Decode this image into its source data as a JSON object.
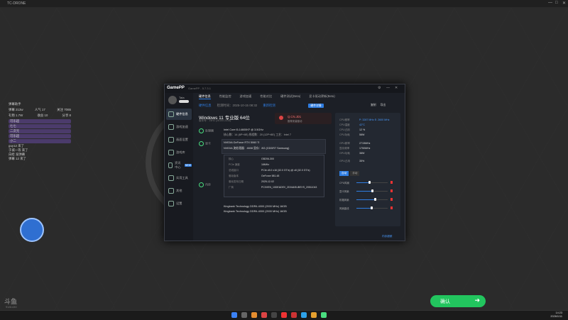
{
  "window": {
    "title": "TC-DRONE"
  },
  "chat": {
    "header": "弹幕助手",
    "stats": [
      [
        "弹幕 213w",
        "人气 17",
        "关注 7065"
      ],
      [
        "礼物 1.7W",
        "收益 10",
        "分享 8"
      ]
    ],
    "hl_lines": [
      "可乐超",
      "七七",
      "二次元",
      "可乐超",
      "小二"
    ],
    "user_lines": [
      "guy12 来了",
      "于城一等 来了",
      "白给 发弹幕",
      "弹幕 12 来了"
    ]
  },
  "app": {
    "logo": "GamePP",
    "version": "GamePP - 5.7.3.1",
    "user": "Tata",
    "nav": [
      "硬件信息",
      "游戏加速",
      "画面设置",
      "游戏库",
      "资讯中心",
      "实用工具",
      "其他",
      "设置"
    ],
    "nav_new": "NEW",
    "tabs": [
      "硬件信息",
      "性能监控",
      "游戏加速",
      "性能对比",
      "硬件测试(Beta)",
      "显卡驱动更新(Beta)"
    ],
    "hw_title": "硬件信息",
    "hw_date": "检测时间：2025-10-15 08:32",
    "hw_refresh": "重新检测",
    "hw_report": "硬件详情",
    "hw_link1": "复制",
    "hw_link2": "导出",
    "os_name": "Windows 11 专业版 64位",
    "os_ver": "版本号：24H2 (26100.2314)",
    "cpu_warn": "Q.CN.JD1",
    "cpu_warn_sub": "推荐安装驱动",
    "section_cpu": "处理器",
    "cpu_line1": "Intel Core i5-14600KF @ 3.5GHz",
    "cpu_line2": "核心数：14 (6P+8E)    线程数：20 (12P+8E)    工艺：Intel 7",
    "section_gpu": "显卡",
    "gpu_line1": "NVIDIA GeForce RTX 5060 Ti",
    "gpu_line2": "NVIDIA    流处理器：4608    显存：8G (GDDR7 Samsung)",
    "popup": [
      [
        "核心",
        "GB206-300"
      ],
      [
        "PCIe 速度",
        "16MHz"
      ],
      [
        "总线接口",
        "PCIe v5.0 x16 (32.0 GT/s) @ x8 (32.0 GT/s)"
      ],
      [
        "驱动版本",
        "GeForce 581.48"
      ],
      [
        "驱动发布日期",
        "2025-12-02"
      ],
      [
        "厂商",
        "PCI\\VEN_10DE&DEV_2D04&SUBSYS_20511043"
      ]
    ],
    "mem_line1": "Kingbank Technology DDR4-4000 (2000 MHz) 16GB",
    "mem_line2": "Kingbank Technology DDR4-4000 (2000 MHz) 16GB",
    "sec_mem": "内存",
    "right": {
      "cpu_clock_label": "CPU频率",
      "cpu_clock": "P: 3287 MHz  E: 2600 MHz",
      "cpu_clock2": "E: 2600 MHz",
      "cpu_temp_label": "CPU温度",
      "cpu_temp": "42°C",
      "cpu_load_label": "CPU占用",
      "cpu_load": "12 %",
      "cpu_power_label": "CPU功耗",
      "cpu_power": "58W",
      "gpu_clock_label": "GPU频率",
      "gpu_clock": "2715MHz",
      "gpu_mem_label": "显存频率",
      "gpu_mem": "1750MHz",
      "gpu_power_label": "GPU功耗",
      "gpu_power": "38W",
      "gpu_load_label": "GPU占用",
      "gpu_load": "35%",
      "toggle_on": "自动",
      "toggle_off": "手动",
      "sliders": [
        {
          "label": "CPU风扇",
          "value": 0.42
        },
        {
          "label": "显卡风扇",
          "value": 0.5
        },
        {
          "label": "机箱风扇",
          "value": 0.6
        },
        {
          "label": "风扇曲线",
          "value": 0.48
        }
      ]
    },
    "footer": "内存超频"
  },
  "confirm_label": "确认",
  "watermark": "斗鱼",
  "watermark_sub": "9181430",
  "clock": {
    "time": "14:23",
    "date": "2026/1/11"
  }
}
